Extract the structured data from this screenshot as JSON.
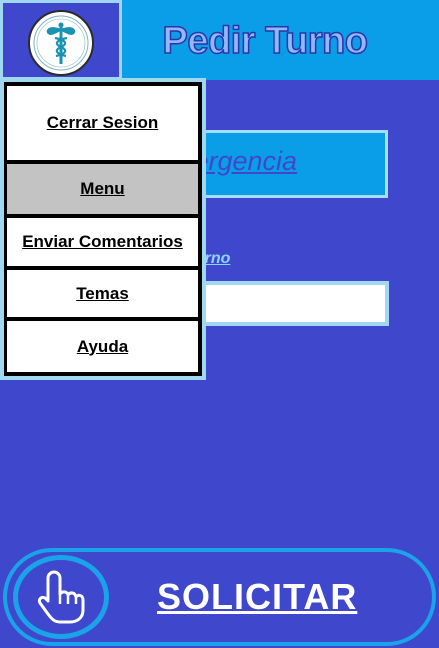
{
  "header": {
    "title": "Pedir Turno",
    "logo_icon": "caduceus-logo-icon"
  },
  "background": {
    "emergency_text": "mergencia",
    "turno_link": "e Turno",
    "input_value": ""
  },
  "menu": {
    "items": [
      {
        "label": "Cerrar Sesion"
      },
      {
        "label": "Menu"
      },
      {
        "label": "Enviar Comentarios"
      },
      {
        "label": "Temas"
      },
      {
        "label": "Ayuda"
      }
    ]
  },
  "solicitar": {
    "label": "SOLICITAR",
    "icon": "hand-pointer-icon"
  },
  "colors": {
    "background": "#3f48cc",
    "accent": "#0a9ee8",
    "menu_header": "#c3c3c3"
  }
}
